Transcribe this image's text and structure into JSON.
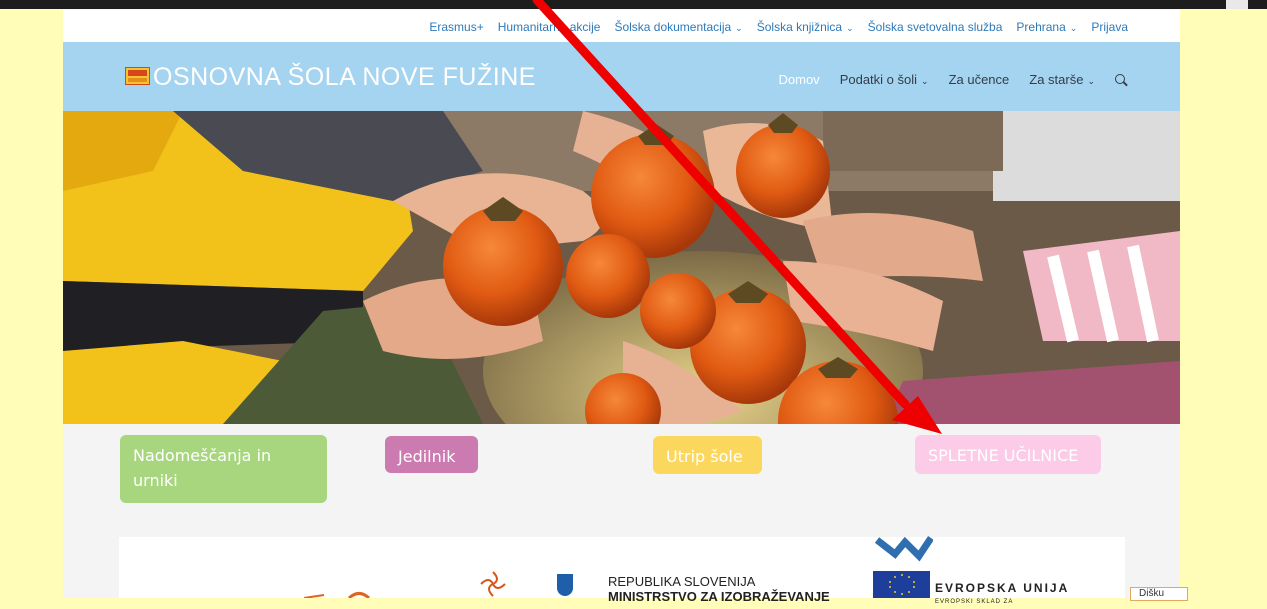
{
  "top_nav": [
    {
      "label": "Erasmus+",
      "has_dropdown": false
    },
    {
      "label": "Humanitarne akcije",
      "has_dropdown": false
    },
    {
      "label": "Šolska dokumentacija",
      "has_dropdown": true
    },
    {
      "label": "Šolska knjižnica",
      "has_dropdown": true
    },
    {
      "label": "Šolska svetovalna služba",
      "has_dropdown": false
    },
    {
      "label": "Prehrana",
      "has_dropdown": true
    },
    {
      "label": "Prijava",
      "has_dropdown": false
    }
  ],
  "header": {
    "title": "OSNOVNA ŠOLA NOVE FUŽINE",
    "nav": [
      {
        "label": "Domov",
        "active": true,
        "has_dropdown": false
      },
      {
        "label": "Podatki o šoli",
        "active": false,
        "has_dropdown": true
      },
      {
        "label": "Za učence",
        "active": false,
        "has_dropdown": false
      },
      {
        "label": "Za starše",
        "active": false,
        "has_dropdown": true
      }
    ],
    "search_icon": "search-icon"
  },
  "hero": {
    "slides": 2,
    "active_slide": 2
  },
  "buttons": [
    {
      "label": "Nadomeščanja in urniki",
      "color": "#a7d67f"
    },
    {
      "label": "Jedilnik",
      "color": "#cc7bb0"
    },
    {
      "label": "Utrip šole",
      "color": "#fcd75e"
    },
    {
      "label": "SPLETNE UČILNICE",
      "color": "#fbcbe8"
    }
  ],
  "partners": {
    "gov_line1": "REPUBLIKA SLOVENIJA",
    "gov_line2": "MINISTRSTVO ZA IZOBRAŽEVANJE",
    "eu_line1": "EVROPSKA UNIJA",
    "eu_line2": "EVROPSKI SKLAD ZA"
  },
  "cookie": {
    "dismiss_label": "Dišku"
  },
  "annotation": {
    "type": "red-arrow",
    "color": "#ee0000"
  },
  "colors": {
    "page_bg": "#fffdb8",
    "header_bg": "#a5d4f1",
    "top_link": "#2e7ab8"
  }
}
